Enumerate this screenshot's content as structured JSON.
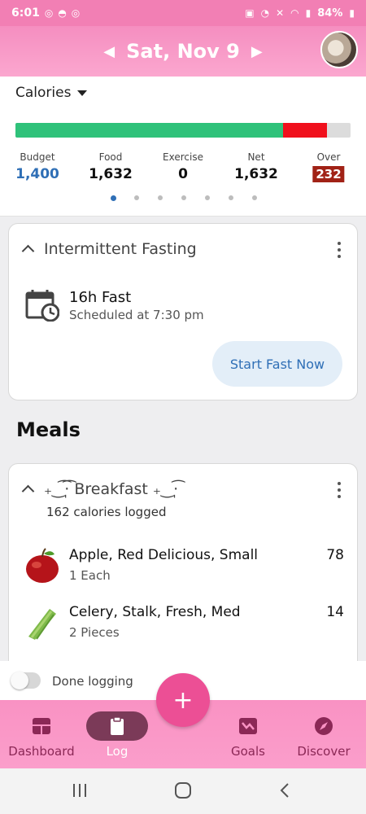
{
  "status_bar": {
    "time": "6:01",
    "battery": "84%"
  },
  "header": {
    "date": "Sat, Nov 9"
  },
  "calories": {
    "selector_label": "Calories",
    "progress": {
      "budget": 1400,
      "food": 1632
    },
    "stats": [
      {
        "label": "Budget",
        "value": "1,400"
      },
      {
        "label": "Food",
        "value": "1,632"
      },
      {
        "label": "Exercise",
        "value": "0"
      },
      {
        "label": "Net",
        "value": "1,632"
      },
      {
        "label": "Over",
        "value": "232"
      }
    ],
    "page_count": 7,
    "active_page": 1
  },
  "fasting": {
    "title": "Intermittent Fasting",
    "plan": "16h Fast",
    "schedule": "Scheduled at 7:30 pm",
    "button_label": "Start Fast Now"
  },
  "meals": {
    "title": "Meals",
    "breakfast": {
      "title": "₊‿͡·̩͡ Breakfast ₊‿·̩͡",
      "calories_logged": "162 calories logged",
      "items": [
        {
          "name": "Apple, Red Delicious, Small",
          "qty": "1 Each",
          "kcal": "78",
          "icon": "apple-icon"
        },
        {
          "name": "Celery, Stalk, Fresh, Med",
          "qty": "2 Pieces",
          "kcal": "14",
          "icon": "celery-icon"
        }
      ]
    }
  },
  "done_logging": {
    "label": "Done logging",
    "on": false
  },
  "fab": {
    "label": "+"
  },
  "nav": [
    {
      "label": "Dashboard",
      "icon": "dashboard-icon"
    },
    {
      "label": "Log",
      "icon": "clipboard-icon",
      "active": true
    },
    {
      "label": "Goals",
      "icon": "goals-chart-icon"
    },
    {
      "label": "Discover",
      "icon": "compass-icon"
    }
  ],
  "colors": {
    "brand_pink": "#f58ec0",
    "fab_pink": "#ec4f95",
    "bar_green": "#2fc27a",
    "bar_red": "#f0101c",
    "accent_blue": "#2f6fb6",
    "over_badge": "#a12216"
  }
}
